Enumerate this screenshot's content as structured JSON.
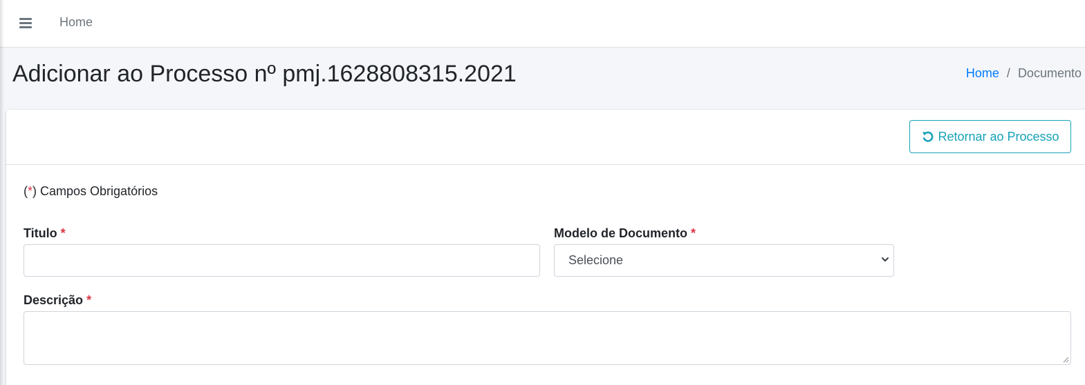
{
  "navbar": {
    "menu_icon": "bars-icon",
    "home_link": "Home"
  },
  "page": {
    "title": "Adicionar ao Processo nº pmj.1628808315.2021",
    "breadcrumb": {
      "home": "Home",
      "separator": "/",
      "current": "Documento"
    }
  },
  "card": {
    "return_button": {
      "icon": "undo-icon",
      "label": "Retornar ao Processo"
    },
    "required_note": {
      "open": "(",
      "asterisk": "*",
      "text": ") Campos Obrigatórios"
    },
    "form": {
      "titulo": {
        "label": "Titulo",
        "asterisk": "*",
        "value": ""
      },
      "modelo": {
        "label": "Modelo de Documento",
        "asterisk": "*",
        "selected": "Selecione"
      },
      "descricao": {
        "label": "Descrição",
        "asterisk": "*",
        "value": ""
      }
    }
  },
  "colors": {
    "accent": "#17a2b8",
    "link": "#007bff",
    "required": "#dc3545",
    "page_bg": "#f4f6f9"
  }
}
